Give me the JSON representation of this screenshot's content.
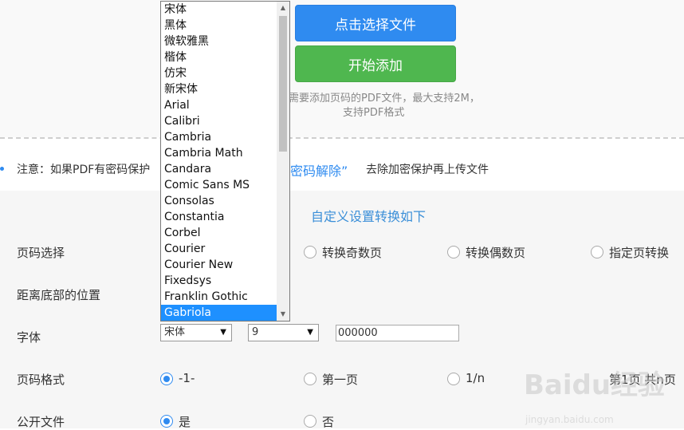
{
  "upload": {
    "choose_button": "点击选择文件",
    "start_button": "开始添加",
    "hint_line1": "需要添加页码的PDF文件，最大支持2M，",
    "hint_line2": "支持PDF格式"
  },
  "notice": {
    "prefix": "注意：如果PDF有密码保护",
    "link": "密码解除”",
    "suffix": "去除加密保护再上传文件"
  },
  "settings": {
    "title": "自定义设置转换如下",
    "page_select": {
      "label": "页码选择",
      "options": [
        "转换奇数页",
        "转换偶数页",
        "指定页转换"
      ]
    },
    "bottom_position": {
      "label": "距离底部的位置"
    },
    "font": {
      "label": "字体",
      "font_value": "宋体",
      "size_value": "9",
      "color_value": "000000"
    },
    "page_format": {
      "label": "页码格式",
      "options": [
        "-1-",
        "第一页",
        "1/n",
        "第1页 共n页"
      ]
    },
    "public_file": {
      "label": "公开文件",
      "options": [
        "是",
        "否"
      ]
    }
  },
  "font_dropdown": {
    "items": [
      "宋体",
      "黑体",
      "微软雅黑",
      "楷体",
      "仿宋",
      "新宋体",
      "Arial",
      "Calibri",
      "Cambria",
      "Cambria Math",
      "Candara",
      "Comic Sans MS",
      "Consolas",
      "Constantia",
      "Corbel",
      "Courier",
      "Courier New",
      "Fixedsys",
      "Franklin Gothic",
      "Gabriola"
    ],
    "highlighted": "Gabriola"
  },
  "watermark": {
    "text": "Baidu经验",
    "url_text": "jingyan.baidu.com"
  },
  "colors": {
    "primary": "#2f8bf0",
    "success": "#4fb74f",
    "highlight": "#1e90ff"
  }
}
